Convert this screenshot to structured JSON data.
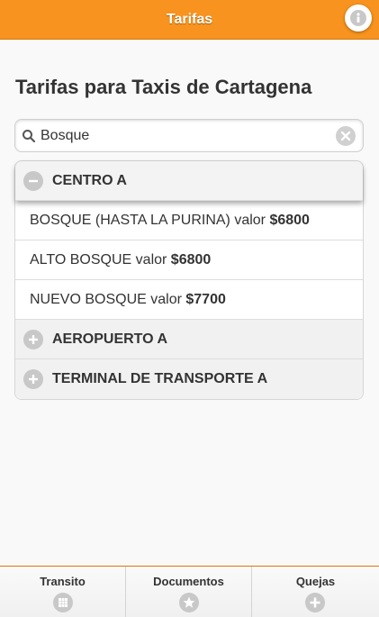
{
  "header": {
    "title": "Tarifas",
    "info_icon": "info-icon",
    "bar_color": "#f7931e"
  },
  "page": {
    "title": "Tarifas para Taxis de Cartagena"
  },
  "search": {
    "value": "Bosque",
    "search_icon": "search-icon",
    "clear_icon": "clear-icon"
  },
  "groups": [
    {
      "label": "CENTRO A",
      "expanded": true,
      "icon": "minus-icon",
      "items": [
        {
          "text": "BOSQUE (HASTA LA PURINA) valor ",
          "price": "$6800"
        },
        {
          "text": "ALTO BOSQUE valor ",
          "price": "$6800"
        },
        {
          "text": "NUEVO BOSQUE valor ",
          "price": "$7700"
        }
      ]
    },
    {
      "label": "AEROPUERTO A",
      "expanded": false,
      "icon": "plus-icon"
    },
    {
      "label": "TERMINAL DE TRANSPORTE A",
      "expanded": false,
      "icon": "plus-icon"
    }
  ],
  "footer": {
    "tabs": [
      {
        "label": "Transito",
        "icon": "grid-icon"
      },
      {
        "label": "Documentos",
        "icon": "star-icon"
      },
      {
        "label": "Quejas",
        "icon": "plus-icon"
      }
    ]
  }
}
